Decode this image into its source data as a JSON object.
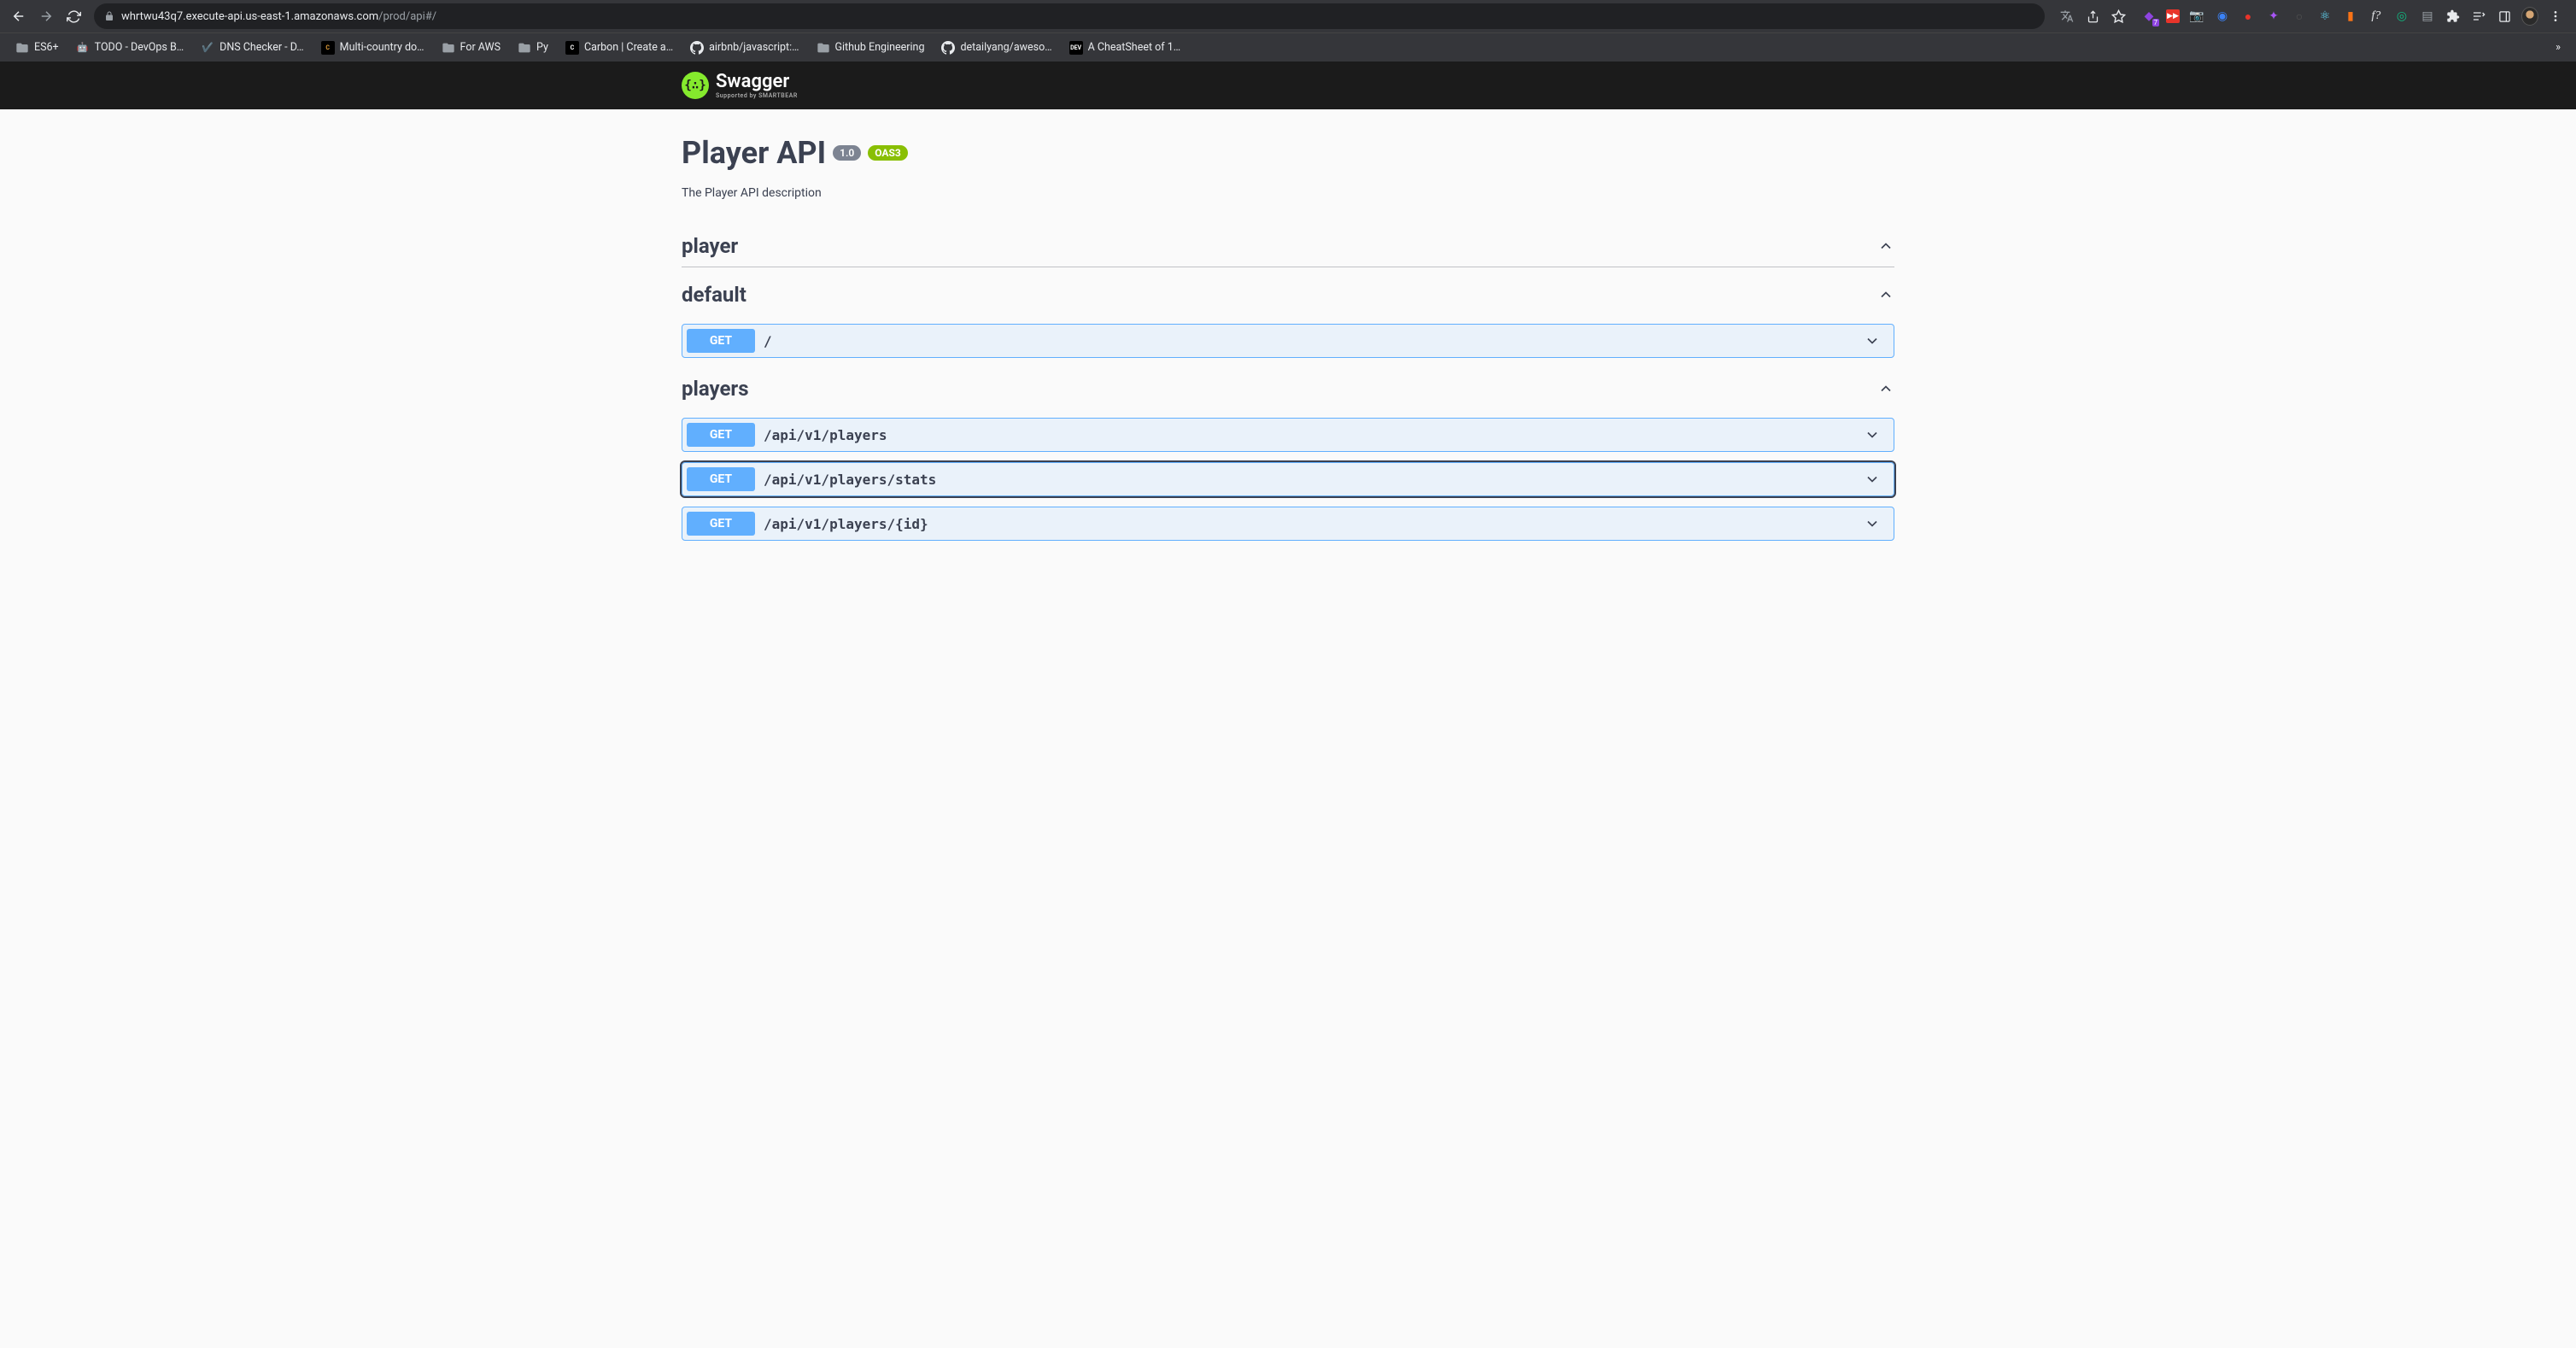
{
  "browser": {
    "url_host": "whrtwu43q7.execute-api.us-east-1.amazonaws.com",
    "url_path": "/prod/api#/",
    "bookmarks": [
      {
        "label": "ES6+",
        "icon": "folder"
      },
      {
        "label": "TODO - DevOps B…",
        "icon": "emoji",
        "glyph": "🤖"
      },
      {
        "label": "DNS Checker - D…",
        "icon": "emoji",
        "glyph": "✔️"
      },
      {
        "label": "Multi-country do…",
        "icon": "letter",
        "glyph": "C",
        "color": "#e6a23c"
      },
      {
        "label": "For AWS",
        "icon": "folder"
      },
      {
        "label": "Py",
        "icon": "folder"
      },
      {
        "label": "Carbon | Create a…",
        "icon": "letter",
        "glyph": "C",
        "color": "#fff"
      },
      {
        "label": "airbnb/javascript:…",
        "icon": "github"
      },
      {
        "label": "Github Engineering",
        "icon": "folder"
      },
      {
        "label": "detailyang/aweso…",
        "icon": "github"
      },
      {
        "label": "A CheatSheet of 1…",
        "icon": "letter",
        "glyph": "DEV",
        "color": "#fff"
      }
    ]
  },
  "swagger": {
    "brand": "Swagger",
    "brand_sub": "Supported by SMARTBEAR"
  },
  "api": {
    "title": "Player API",
    "version": "1.0",
    "oas": "OAS3",
    "description": "The Player API description",
    "tags": [
      {
        "name": "player",
        "expanded": true,
        "operations": []
      },
      {
        "name": "default",
        "expanded": true,
        "operations": [
          {
            "method": "GET",
            "path": "/"
          }
        ]
      },
      {
        "name": "players",
        "expanded": true,
        "operations": [
          {
            "method": "GET",
            "path": "/api/v1/players"
          },
          {
            "method": "GET",
            "path": "/api/v1/players/stats",
            "focused": true
          },
          {
            "method": "GET",
            "path": "/api/v1/players/{id}"
          }
        ]
      }
    ]
  }
}
